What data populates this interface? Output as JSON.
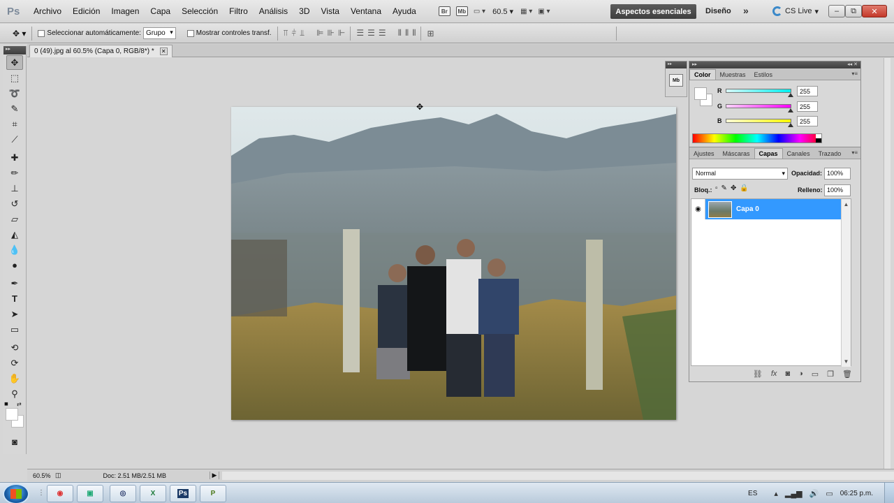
{
  "menubar": {
    "logo": "Ps",
    "items": [
      "Archivo",
      "Edición",
      "Imagen",
      "Capa",
      "Selección",
      "Filtro",
      "Análisis",
      "3D",
      "Vista",
      "Ventana",
      "Ayuda"
    ],
    "bridge_label": "Br",
    "minibridge_label": "Mb",
    "zoom": "60.5",
    "workspace_active": "Aspectos esenciales",
    "workspace_design": "Diseño",
    "more": "»",
    "cslive": "CS Live",
    "minimize": "–",
    "maximize": "⧉",
    "close": "✕"
  },
  "options": {
    "auto_select_label": "Seleccionar automáticamente:",
    "auto_select_value": "Grupo",
    "show_transform_label": "Mostrar controles transf."
  },
  "document": {
    "tab_title": "0 (49).jpg al 60.5% (Capa 0, RGB/8*) *",
    "tab_close": "✕"
  },
  "status": {
    "zoom": "60.5%",
    "doc_info": "Doc: 2.51 MB/2.51 MB",
    "arrow": "▶"
  },
  "mini_strip": {
    "icon_label": "Mb"
  },
  "color_panel": {
    "tabs": [
      "Color",
      "Muestras",
      "Estilos"
    ],
    "active_tab": 0,
    "sliders": [
      {
        "label": "R",
        "value": "255",
        "color_from": "#d6f7f7",
        "color_to": "#00f0f0"
      },
      {
        "label": "G",
        "value": "255",
        "color_from": "#ffd6ff",
        "color_to": "#ff00ff"
      },
      {
        "label": "B",
        "value": "255",
        "color_from": "#ffffd6",
        "color_to": "#ffff00"
      }
    ]
  },
  "layers_panel": {
    "tabs": [
      "Ajustes",
      "Máscaras",
      "Capas",
      "Canales",
      "Trazado"
    ],
    "active_tab": 2,
    "blend_mode": "Normal",
    "opacity_label": "Opacidad:",
    "opacity_value": "100%",
    "lock_label": "Bloq.:",
    "fill_label": "Relleno:",
    "fill_value": "100%",
    "layers": [
      {
        "name": "Capa 0",
        "visible": true,
        "selected": true
      }
    ]
  },
  "taskbar": {
    "apps": [
      "chrome-icon",
      "explorer-icon",
      "media-player-icon",
      "excel-icon",
      "photoshop-icon",
      "project-icon"
    ],
    "app_labels": [
      "◉",
      "▣",
      "◎",
      "X",
      "Ps",
      "P"
    ],
    "language": "ES",
    "time": "06:25 p.m."
  },
  "colors": {
    "selection": "#3399ff",
    "workspace_bg": "#d6d6d6"
  }
}
